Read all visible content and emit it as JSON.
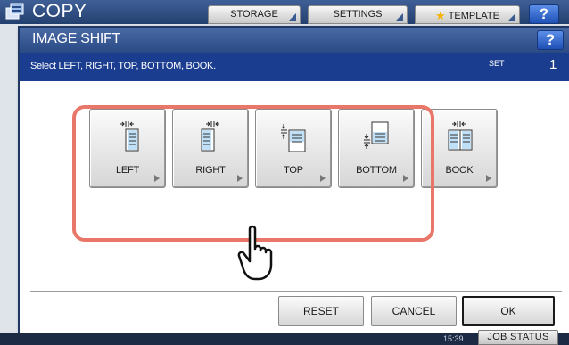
{
  "app": {
    "title": "COPY",
    "tabs": [
      "STORAGE",
      "SETTINGS",
      "TEMPLATE"
    ],
    "help_label": "?",
    "time": "15:39",
    "job_status_label": "JOB STATUS"
  },
  "dialog": {
    "title": "IMAGE SHIFT",
    "help_label": "?",
    "instruction": "Select LEFT, RIGHT, TOP, BOTTOM, BOOK.",
    "set_label": "SET",
    "set_count": "1"
  },
  "options": [
    {
      "label": "LEFT",
      "icon": "shift-left-icon"
    },
    {
      "label": "RIGHT",
      "icon": "shift-right-icon"
    },
    {
      "label": "TOP",
      "icon": "shift-top-icon"
    },
    {
      "label": "BOTTOM",
      "icon": "shift-bottom-icon"
    },
    {
      "label": "BOOK",
      "icon": "book-icon"
    }
  ],
  "footer": {
    "reset_label": "RESET",
    "cancel_label": "CANCEL",
    "ok_label": "OK"
  },
  "colors": {
    "title_bar": "#2a4a85",
    "instruction_bar": "#1b3d8f",
    "highlight": "#e8776a"
  }
}
